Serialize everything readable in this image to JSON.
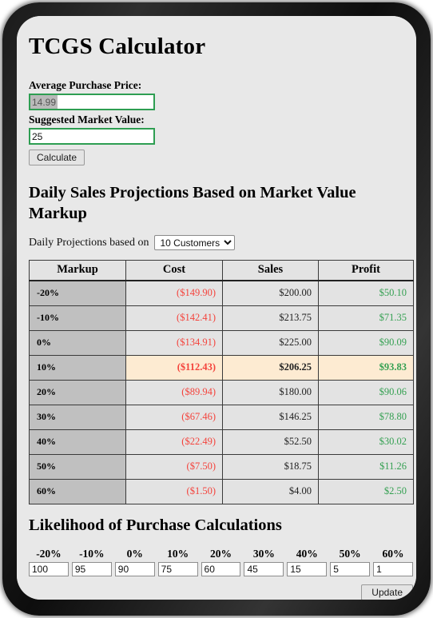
{
  "app": {
    "title": "TCGS Calculator"
  },
  "form": {
    "purchase_price_label": "Average Purchase Price:",
    "purchase_price_value": "14.99",
    "market_value_label": "Suggested Market Value:",
    "market_value_value": "25",
    "calculate_label": "Calculate"
  },
  "projections": {
    "heading": "Daily Sales Projections Based on Market Value Markup",
    "select_prefix": "Daily Projections based on",
    "selected_customers": "10 Customers",
    "customer_options": [
      "10 Customers"
    ],
    "dropdown_icon": "chevron-down-icon",
    "columns": [
      "Markup",
      "Cost",
      "Sales",
      "Profit"
    ],
    "highlight_color": "#fdebd2",
    "cost_color": "#f4433c",
    "profit_color": "#35a052",
    "rows": [
      {
        "markup": "-20%",
        "cost": "($149.90)",
        "sales": "$200.00",
        "profit": "$50.10",
        "highlight": false
      },
      {
        "markup": "-10%",
        "cost": "($142.41)",
        "sales": "$213.75",
        "profit": "$71.35",
        "highlight": false
      },
      {
        "markup": "0%",
        "cost": "($134.91)",
        "sales": "$225.00",
        "profit": "$90.09",
        "highlight": false
      },
      {
        "markup": "10%",
        "cost": "($112.43)",
        "sales": "$206.25",
        "profit": "$93.83",
        "highlight": true
      },
      {
        "markup": "20%",
        "cost": "($89.94)",
        "sales": "$180.00",
        "profit": "$90.06",
        "highlight": false
      },
      {
        "markup": "30%",
        "cost": "($67.46)",
        "sales": "$146.25",
        "profit": "$78.80",
        "highlight": false
      },
      {
        "markup": "40%",
        "cost": "($22.49)",
        "sales": "$52.50",
        "profit": "$30.02",
        "highlight": false
      },
      {
        "markup": "50%",
        "cost": "($7.50)",
        "sales": "$18.75",
        "profit": "$11.26",
        "highlight": false
      },
      {
        "markup": "60%",
        "cost": "($1.50)",
        "sales": "$4.00",
        "profit": "$2.50",
        "highlight": false
      }
    ]
  },
  "likelihood": {
    "heading": "Likelihood of Purchase Calculations",
    "update_label": "Update",
    "fields": [
      {
        "label": "-20%",
        "value": "100"
      },
      {
        "label": "-10%",
        "value": "95"
      },
      {
        "label": "0%",
        "value": "90"
      },
      {
        "label": "10%",
        "value": "75"
      },
      {
        "label": "20%",
        "value": "60"
      },
      {
        "label": "30%",
        "value": "45"
      },
      {
        "label": "40%",
        "value": "15"
      },
      {
        "label": "50%",
        "value": "5"
      },
      {
        "label": "60%",
        "value": "1"
      }
    ]
  }
}
